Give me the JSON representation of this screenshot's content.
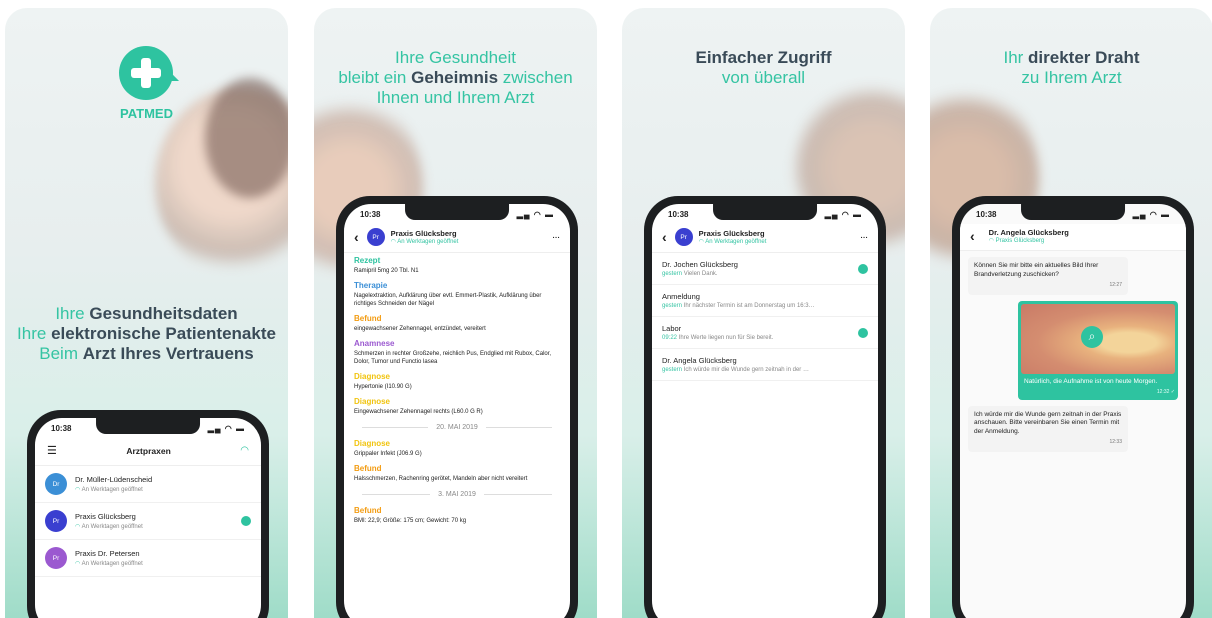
{
  "panel1": {
    "logo_text": "PATMED",
    "lines": [
      {
        "a": "Ihre ",
        "b": "Gesundheitsdaten",
        "c": ""
      },
      {
        "a": "Ihre ",
        "b": "elektronische Patientenakte",
        "c": ""
      },
      {
        "a": "Beim ",
        "b": "Arzt Ihres Vertrauens",
        "c": ""
      }
    ],
    "phone": {
      "time": "10:38",
      "title": "Arztpraxen",
      "items": [
        {
          "av": "Dr",
          "color": "#3b8fd6",
          "name": "Dr. Müller-Lüdenscheid",
          "sub": "An Werktagen geöffnet",
          "badge": false
        },
        {
          "av": "Pr",
          "color": "#3a3fd0",
          "name": "Praxis Glücksberg",
          "sub": "An Werktagen geöffnet",
          "badge": true
        },
        {
          "av": "Pr",
          "color": "#9b59d0",
          "name": "Praxis Dr. Petersen",
          "sub": "An Werktagen geöffnet",
          "badge": false
        }
      ]
    }
  },
  "panel2": {
    "h1": "Ihre Gesundheit",
    "h2a": "bleibt ein ",
    "h2b": "Geheimnis",
    "h2c": " zwischen",
    "h3": "Ihnen und Ihrem Arzt",
    "phone": {
      "time": "10:38",
      "name": "Praxis Glücksberg",
      "sub": "An Werktagen geöffnet",
      "av": "Pr",
      "entries": [
        {
          "t": "Rezept",
          "c": "#2ec3a0",
          "d": "Ramipril 5mg 20 Tbl. N1"
        },
        {
          "t": "Therapie",
          "c": "#3b8fd6",
          "d": "Nagelextraktion, Aufklärung über evtl. Emmert-Plastik, Aufklärung über richtiges Schneiden der Nägel"
        },
        {
          "t": "Befund",
          "c": "#f39c12",
          "d": "eingewachsener Zehennagel, entzündet, vereitert"
        },
        {
          "t": "Anamnese",
          "c": "#9b59d0",
          "d": "Schmerzen in rechter Großzehe, reichlich Pus, Endglied mit Rubox, Calor, Dolor, Tumor und Functio lasea"
        },
        {
          "t": "Diagnose",
          "c": "#f1c40f",
          "d": "Hypertonie (I10.90 G)"
        },
        {
          "t": "Diagnose",
          "c": "#f1c40f",
          "d": "Eingewachsener Zehennagel rechts (L60.0 G R)"
        }
      ],
      "sep1": "20. MAI 2019",
      "entries2": [
        {
          "t": "Diagnose",
          "c": "#f1c40f",
          "d": "Grippaler Infekt (J06.9 G)"
        },
        {
          "t": "Befund",
          "c": "#f39c12",
          "d": "Halsschmerzen, Rachenring gerötet, Mandeln aber nicht vereitert"
        }
      ],
      "sep2": "3. MAI 2019",
      "entries3": [
        {
          "t": "Befund",
          "c": "#f39c12",
          "d": "BMI: 22,9; Größe: 175 cm; Gewicht: 70 kg"
        }
      ]
    }
  },
  "panel3": {
    "h1": "Einfacher Zugriff",
    "h2": "von überall",
    "phone": {
      "time": "10:38",
      "name": "Praxis Glücksberg",
      "sub": "An Werktagen geöffnet",
      "av": "Pr",
      "rows": [
        {
          "n": "Dr. Jochen Glücksberg",
          "w": "gestern",
          "s": "Vielen Dank.",
          "badge": true
        },
        {
          "n": "Anmeldung",
          "w": "gestern",
          "s": "Ihr nächster Termin ist am Donnerstag um 16:3…",
          "badge": false
        },
        {
          "n": "Labor",
          "w": "09:22",
          "s": "Ihre Werte liegen nun für Sie bereit.",
          "badge": true
        },
        {
          "n": "Dr. Angela Glücksberg",
          "w": "gestern",
          "s": "Ich würde mir die Wunde gern zeitnah in der …",
          "badge": false
        }
      ]
    }
  },
  "panel4": {
    "h1a": "Ihr ",
    "h1b": "direkter Draht",
    "h2": "zu Ihrem Arzt",
    "phone": {
      "time": "10:38",
      "name": "Dr. Angela Glücksberg",
      "sub": "Praxis Glücksberg",
      "m1": "Können Sie mir bitte ein aktuelles Bild Ihrer Brandverletzung zuschicken?",
      "m1t": "12:27",
      "m2": "Natürlich, die Aufnahme ist von heute Morgen.",
      "m2t": "12:32 ✓",
      "m3": "Ich würde mir die Wunde gern zeitnah in der Praxis anschauen. Bitte vereinbaren Sie einen Termin mit der Anmeldung.",
      "m3t": "12:33"
    }
  }
}
